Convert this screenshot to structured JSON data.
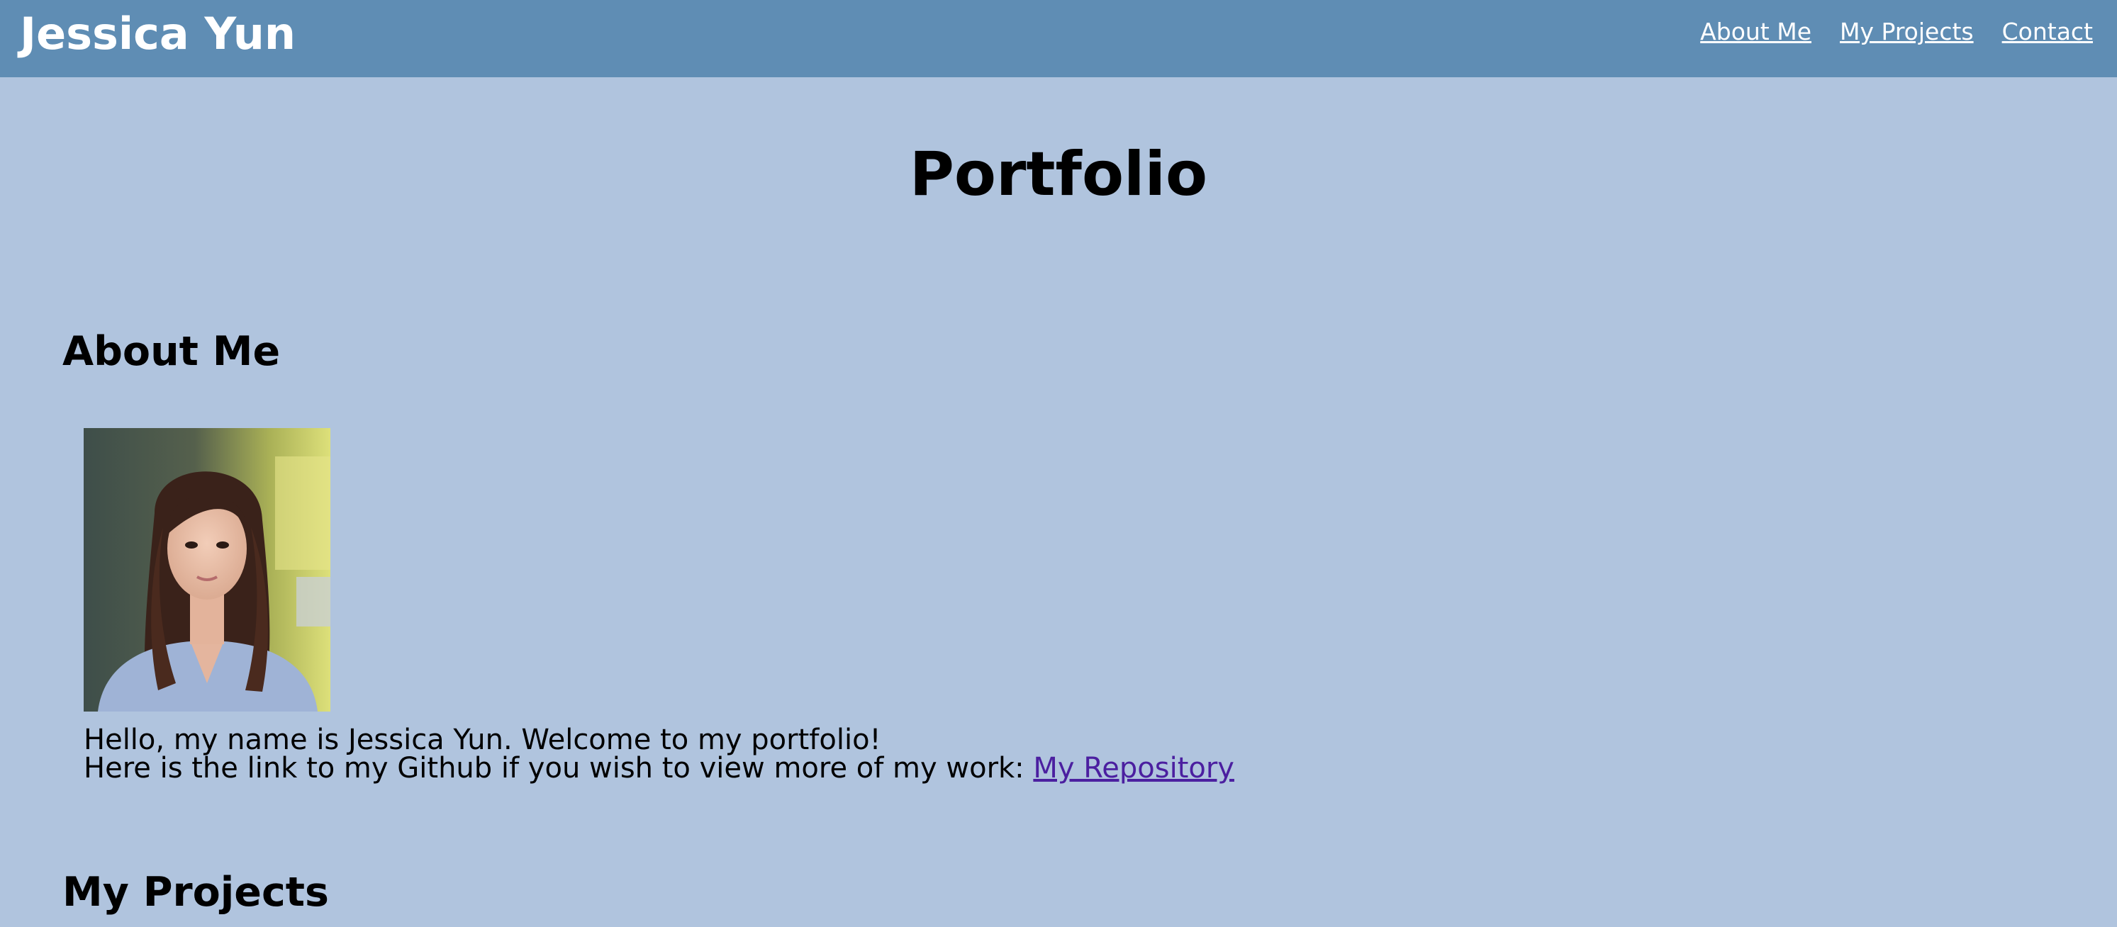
{
  "header": {
    "brand": "Jessica Yun",
    "nav": [
      {
        "label": "About Me"
      },
      {
        "label": "My Projects"
      },
      {
        "label": "Contact"
      }
    ]
  },
  "main": {
    "title": "Portfolio",
    "about": {
      "heading": "About Me",
      "greeting": "Hello, my name is Jessica Yun. Welcome to my portfolio!",
      "github_text": "Here is the link to my Github if you wish to view more of my work: ",
      "repo_link_label": "My Repository"
    },
    "projects": {
      "heading": "My Projects"
    }
  },
  "colors": {
    "header_bg": "#5f8db4",
    "page_bg": "#b0c4de",
    "link_visited": "#4b1fa0"
  }
}
